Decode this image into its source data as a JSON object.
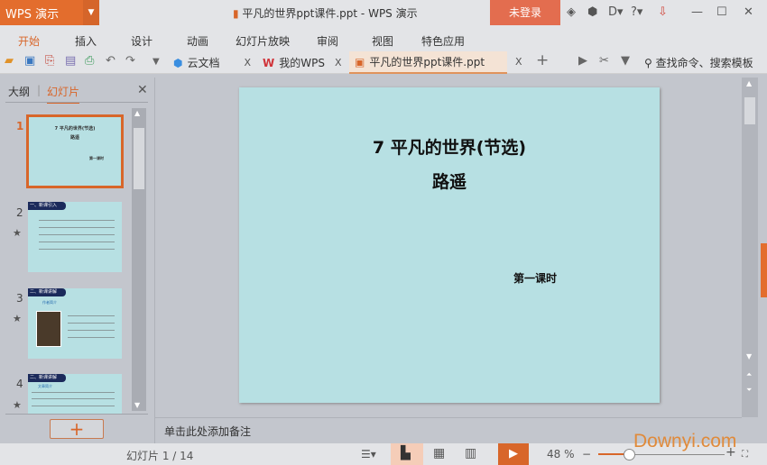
{
  "app": {
    "logo": "WPS 演示",
    "title": "平凡的世界ppt课件.ppt - WPS 演示",
    "login": "未登录"
  },
  "menu": [
    "开始",
    "插入",
    "设计",
    "动画",
    "幻灯片放映",
    "审阅",
    "视图",
    "特色应用"
  ],
  "tabs": [
    {
      "label": "云文档"
    },
    {
      "label": "我的WPS"
    },
    {
      "label": "平凡的世界ppt课件.ppt"
    }
  ],
  "search": {
    "label": "查找命令、搜索模板"
  },
  "panel": {
    "tab_outline": "大纲",
    "tab_slides": "幻灯片"
  },
  "thumbs": [
    {
      "num": "1"
    },
    {
      "num": "2",
      "header": "一、新课引入"
    },
    {
      "num": "3",
      "header": "二、新课讲解",
      "sub": "作者简介"
    },
    {
      "num": "4",
      "header": "二、新课讲解",
      "sub": "文章简介"
    }
  ],
  "slide": {
    "title": "7 平凡的世界(节选)",
    "author": "路遥",
    "lesson": "第一课时"
  },
  "notes": {
    "placeholder": "单击此处添加备注"
  },
  "status": {
    "slide_counter": "幻灯片 1 / 14",
    "zoom": "48 %",
    "zoom_fraction": 0.48
  },
  "watermark": "Downyi.com",
  "colors": {
    "accent": "#d8662a",
    "slide_bg": "#b7e0e3"
  }
}
